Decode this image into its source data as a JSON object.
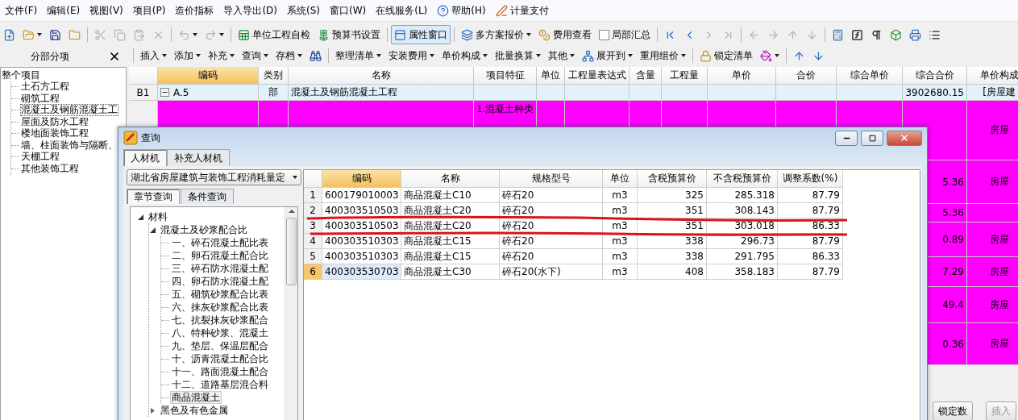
{
  "menu": [
    {
      "kind": "text",
      "label": "文件(F)"
    },
    {
      "kind": "text",
      "label": "编辑(E)"
    },
    {
      "kind": "text",
      "label": "视图(V)"
    },
    {
      "kind": "text",
      "label": "项目(P)"
    },
    {
      "kind": "text",
      "label": "造价指标"
    },
    {
      "kind": "text",
      "label": "导入导出(D)"
    },
    {
      "kind": "text",
      "label": "系统(S)"
    },
    {
      "kind": "text",
      "label": "窗口(W)"
    },
    {
      "kind": "text",
      "label": "在线服务(L)"
    },
    {
      "kind": "help",
      "label": "帮助(H)"
    },
    {
      "kind": "pay",
      "label": "计量支付"
    }
  ],
  "toolbar": [
    {
      "kind": "new",
      "dropdown": false
    },
    {
      "kind": "open",
      "dropdown": true
    },
    {
      "kind": "save",
      "dropdown": false
    },
    {
      "kind": "folder",
      "dropdown": false
    },
    {
      "kind": "sep"
    },
    {
      "kind": "cut",
      "disabled": true
    },
    {
      "kind": "copy",
      "disabled": true
    },
    {
      "kind": "paste",
      "disabled": true
    },
    {
      "kind": "delete",
      "disabled": true
    },
    {
      "kind": "sep"
    },
    {
      "kind": "undo",
      "disabled": true,
      "dropdown": true
    },
    {
      "kind": "redo",
      "disabled": true,
      "dropdown": true
    },
    {
      "kind": "sep"
    },
    {
      "kind": "check",
      "label": "单位工程自检"
    },
    {
      "kind": "settings",
      "label": "预算书设置"
    },
    {
      "kind": "sep"
    },
    {
      "kind": "property",
      "label": "属性窗口",
      "pressed": true
    },
    {
      "kind": "sep"
    },
    {
      "kind": "scheme",
      "label": "多方案报价",
      "dropdown": true
    },
    {
      "kind": "fees",
      "label": "费用查看"
    },
    {
      "kind": "checkbox",
      "label": "局部汇总",
      "checked": false
    },
    {
      "kind": "sep"
    },
    {
      "kind": "first"
    },
    {
      "kind": "prev"
    },
    {
      "kind": "next",
      "disabled": true
    },
    {
      "kind": "last",
      "disabled": true
    },
    {
      "kind": "sep"
    },
    {
      "kind": "left",
      "disabled": true
    },
    {
      "kind": "right",
      "disabled": true
    },
    {
      "kind": "up",
      "disabled": true
    },
    {
      "kind": "down",
      "disabled": true
    },
    {
      "kind": "sep"
    },
    {
      "kind": "calc"
    },
    {
      "kind": "fx"
    },
    {
      "kind": "pilcrow"
    },
    {
      "kind": "cube"
    },
    {
      "kind": "report"
    },
    {
      "kind": "list"
    }
  ],
  "panel": {
    "title": "分部分项"
  },
  "toolbar2": [
    {
      "kind": "menu",
      "label": "插入",
      "dropdown": true
    },
    {
      "kind": "menu",
      "label": "添加",
      "dropdown": true
    },
    {
      "kind": "menu",
      "label": "补充",
      "dropdown": true
    },
    {
      "kind": "menu",
      "label": "查询",
      "dropdown": true
    },
    {
      "kind": "menu",
      "label": "存档",
      "dropdown": true
    },
    {
      "kind": "find"
    },
    {
      "kind": "sep"
    },
    {
      "kind": "menu",
      "label": "整理清单",
      "dropdown": true
    },
    {
      "kind": "menu",
      "label": "安装费用",
      "dropdown": true
    },
    {
      "kind": "menu",
      "label": "单价构成",
      "dropdown": true
    },
    {
      "kind": "menu",
      "label": "批量换算",
      "dropdown": true
    },
    {
      "kind": "menu",
      "label": "其他",
      "dropdown": true
    },
    {
      "kind": "expand",
      "label": "展开到",
      "dropdown": true
    },
    {
      "kind": "menu",
      "label": "重用组价",
      "dropdown": true
    },
    {
      "kind": "sep"
    },
    {
      "kind": "lock",
      "label": "锁定清单"
    },
    {
      "kind": "paint",
      "dropdown": true
    },
    {
      "kind": "sep"
    },
    {
      "kind": "up"
    },
    {
      "kind": "down"
    }
  ],
  "project_tree": {
    "label": "整个项目",
    "children": [
      {
        "label": "土石方工程",
        "selected": false
      },
      {
        "label": "砌筑工程",
        "selected": false
      },
      {
        "label": "混凝土及钢筋混凝土工",
        "selected": true
      },
      {
        "label": "屋面及防水工程",
        "selected": false
      },
      {
        "label": "楼地面装饰工程",
        "selected": false
      },
      {
        "label": "墙、柱面装饰与隔断、",
        "selected": false
      },
      {
        "label": "天棚工程",
        "selected": false
      },
      {
        "label": "其他装饰工程",
        "selected": false
      }
    ]
  },
  "grid": {
    "columns": [
      {
        "label": "编码",
        "focused": true
      },
      {
        "label": "类别",
        "focused": false
      },
      {
        "label": "名称",
        "focused": false
      },
      {
        "label": "项目特征",
        "focused": false
      },
      {
        "label": "单位",
        "focused": false
      },
      {
        "label": "工程量表达式",
        "focused": false
      },
      {
        "label": "含量",
        "focused": false
      },
      {
        "label": "工程量",
        "focused": false
      },
      {
        "label": "单价",
        "focused": false
      },
      {
        "label": "合价",
        "focused": false
      },
      {
        "label": "综合单价",
        "focused": false
      },
      {
        "label": "综合合价",
        "focused": false
      },
      {
        "label": "单价构成",
        "focused": false
      }
    ],
    "rows": [
      {
        "kind": "group",
        "row_header": "B1",
        "expanded": true,
        "code": "A.5",
        "type": "部",
        "name": "混凝土及钢筋混凝土工程",
        "total": "3902680.15",
        "composition": "[房屋建"
      },
      {
        "kind": "item",
        "features": "1.混凝土种类",
        "composition": "房屋"
      },
      {
        "kind": "item",
        "total": "5.36",
        "composition": "房屋"
      },
      {
        "kind": "item",
        "total": "5.36"
      },
      {
        "kind": "item",
        "total": "0.89",
        "composition": "房屋"
      },
      {
        "kind": "item",
        "total": "7.29",
        "composition": "房屋"
      },
      {
        "kind": "item",
        "total": "49.4",
        "composition": "房屋"
      },
      {
        "kind": "item",
        "total": "0.36",
        "composition": "房屋"
      }
    ]
  },
  "bottom_buttons": [
    {
      "label": "锁定数",
      "disabled": false
    },
    {
      "label": "插入",
      "disabled": true
    }
  ],
  "dialog": {
    "title": "查询",
    "tabs": [
      {
        "label": "人材机",
        "selected": true
      },
      {
        "label": "补充人材机",
        "selected": false
      }
    ],
    "library": "湖北省房屋建筑与装饰工程消耗量定",
    "search_tabs": [
      {
        "label": "章节查询",
        "selected": true
      },
      {
        "label": "条件查询",
        "selected": false
      }
    ],
    "tree": [
      {
        "label": "材料",
        "expanded": true,
        "children": [
          {
            "label": "混凝土及砂浆配合比",
            "expanded": true,
            "children": [
              {
                "label": "一、碎石混凝土配比表",
                "selected": false
              },
              {
                "label": "二、卵石混凝土配合比",
                "selected": false
              },
              {
                "label": "三、碎石防水混凝土配",
                "selected": false
              },
              {
                "label": "四、卵石防水混凝土配",
                "selected": false
              },
              {
                "label": "五、砌筑砂浆配合比表",
                "selected": false
              },
              {
                "label": "六、抹灰砂浆配合比表",
                "selected": false
              },
              {
                "label": "七、抗裂抹灰砂浆配合",
                "selected": false
              },
              {
                "label": "八、特种砂浆、混凝土",
                "selected": false
              },
              {
                "label": "九、垫层、保温层配合",
                "selected": false
              },
              {
                "label": "十、沥青混凝土配合比",
                "selected": false
              },
              {
                "label": "十一、路面混凝土配合",
                "selected": false
              },
              {
                "label": "十二、道路基层混合料",
                "selected": false
              },
              {
                "label": "商品混凝土",
                "selected": true
              }
            ]
          },
          {
            "label": "黑色及有色金属",
            "expanded": false
          }
        ]
      }
    ],
    "table": {
      "columns": [
        {
          "label": "编码",
          "focused": true
        },
        {
          "label": "名称",
          "focused": false
        },
        {
          "label": "规格型号",
          "focused": false
        },
        {
          "label": "单位",
          "focused": false
        },
        {
          "label": "含税预算价",
          "focused": false
        },
        {
          "label": "不含税预算价",
          "focused": false
        },
        {
          "label": "调整系数(%)",
          "focused": false
        }
      ],
      "rows": [
        {
          "number": "1",
          "code": "600179010003",
          "name": "商品混凝土C10",
          "spec": "碎石20",
          "unit": "m3",
          "price_tax": "325",
          "price_notax": "285.318",
          "factor": "87.79",
          "selected": false
        },
        {
          "number": "2",
          "code": "400303510503",
          "name": "商品混凝土C20",
          "spec": "碎石20",
          "unit": "m3",
          "price_tax": "351",
          "price_notax": "308.143",
          "factor": "87.79",
          "selected": false
        },
        {
          "number": "3",
          "code": "400303510503",
          "name": "商品混凝土C20",
          "spec": "碎石20",
          "unit": "m3",
          "price_tax": "351",
          "price_notax": "303.018",
          "factor": "86.33",
          "selected": false
        },
        {
          "number": "4",
          "code": "400303510303",
          "name": "商品混凝土C15",
          "spec": "碎石20",
          "unit": "m3",
          "price_tax": "338",
          "price_notax": "296.73",
          "factor": "87.79",
          "selected": false
        },
        {
          "number": "5",
          "code": "400303510303",
          "name": "商品混凝土C15",
          "spec": "碎石20",
          "unit": "m3",
          "price_tax": "338",
          "price_notax": "291.795",
          "factor": "86.33",
          "selected": false
        },
        {
          "number": "6",
          "code": "400303530703",
          "name": "商品混凝土C30",
          "spec": "碎石20(水下)",
          "unit": "m3",
          "price_tax": "408",
          "price_notax": "358.183",
          "factor": "87.79",
          "selected": true
        }
      ]
    }
  }
}
